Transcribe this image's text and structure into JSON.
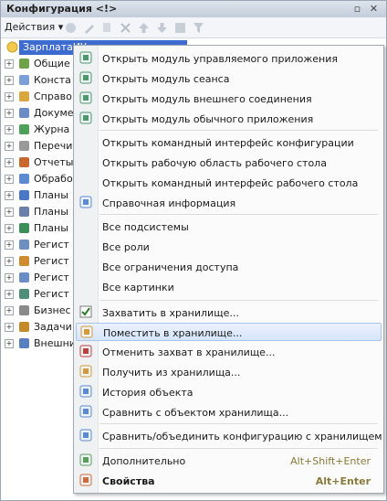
{
  "window": {
    "title": "Конфигурация <!>",
    "pin_glyph": "▫",
    "close_glyph": "✕"
  },
  "toolbar": {
    "actions_label": "Действия ▾"
  },
  "tree": {
    "root": "ЗарплатаИУ",
    "items": [
      "Общие",
      "Конста",
      "Справо",
      "Докуме",
      "Журна",
      "Перечи",
      "Отчеты",
      "Обрабо",
      "Планы",
      "Планы",
      "Планы",
      "Регист",
      "Регист",
      "Регист",
      "Регист",
      "Бизнес",
      "Задачи",
      "Внешни"
    ]
  },
  "menu": {
    "items": [
      {
        "label": "Открыть модуль управляемого приложения",
        "icon": "module-icon"
      },
      {
        "label": "Открыть модуль сеанса",
        "icon": "module-icon"
      },
      {
        "label": "Открыть модуль внешнего соединения",
        "icon": "module-icon"
      },
      {
        "label": "Открыть модуль обычного приложения",
        "icon": "module-icon"
      },
      {
        "label": "Открыть командный интерфейс конфигурации"
      },
      {
        "label": "Открыть рабочую область рабочего стола"
      },
      {
        "label": "Открыть командный интерфейс рабочего стола"
      },
      {
        "label": "Справочная информация",
        "icon": "help-icon"
      },
      {
        "label": "Все подсистемы"
      },
      {
        "label": "Все роли"
      },
      {
        "label": "Все ограничения доступа"
      },
      {
        "label": "Все картинки"
      },
      {
        "label": "Захватить в хранилище...",
        "icon": "checkbox-icon"
      },
      {
        "label": "Поместить в хранилище...",
        "icon": "put-icon"
      },
      {
        "label": "Отменить захват в хранилище...",
        "icon": "undo-icon"
      },
      {
        "label": "Получить из хранилища...",
        "icon": "get-icon"
      },
      {
        "label": "История объекта",
        "icon": "history-icon"
      },
      {
        "label": "Сравнить с объектом хранилища...",
        "icon": "compare-icon"
      },
      {
        "label": "Сравнить/объединить конфигурацию с хранилищем",
        "icon": "merge-icon"
      },
      {
        "label": "Дополнительно",
        "shortcut": "Alt+Shift+Enter",
        "icon": "more-icon"
      },
      {
        "label": "Свойства",
        "shortcut": "Alt+Enter",
        "icon": "properties-icon"
      }
    ]
  },
  "colors": {
    "highlight": "#d6e5fa",
    "selection": "#3d6bd0",
    "shortcut": "#8a7a3a"
  }
}
